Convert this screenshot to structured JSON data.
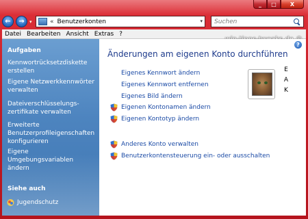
{
  "window": {
    "min_label": "_",
    "max_label": "□",
    "close_label": "X"
  },
  "nav": {
    "back_label": "←",
    "forward_label": "→",
    "dropdown_label": "▾",
    "address_separator": "«",
    "address_text": "Benutzerkonten",
    "address_dropdown_label": "▾",
    "refresh_label": "↻",
    "search_placeholder": "Suchen"
  },
  "menubar": {
    "items": [
      {
        "label": "Datei"
      },
      {
        "label": "Bearbeiten"
      },
      {
        "label": "Ansicht"
      },
      {
        "label": "Extras"
      },
      {
        "label": "?"
      }
    ]
  },
  "watermark": "win-tipps-tweaks.de ©",
  "sidebar": {
    "tasks_heading": "Aufgaben",
    "links": [
      {
        "label": "Kennwortrücksetzdiskette erstellen"
      },
      {
        "label": "Eigene Netzwerkkennwörter verwalten"
      },
      {
        "label": "Dateiverschlüsselungs-zertifikate verwalten"
      },
      {
        "label": "Erweiterte Benutzerprofileigenschaften konfigurieren"
      },
      {
        "label": "Eigene Umgebungsvariablen ändern"
      }
    ],
    "see_also_heading": "Siehe auch",
    "see_also_link": "Jugendschutz"
  },
  "main": {
    "help_label": "?",
    "title": "Änderungen am eigenen Konto durchführen",
    "plain_links": [
      {
        "label": "Eigenes Kennwort ändern"
      },
      {
        "label": "Eigenes Kennwort entfernen"
      },
      {
        "label": "Eigenes Bild ändern"
      }
    ],
    "shield_links": [
      {
        "label": "Eigenen Kontonamen ändern"
      },
      {
        "label": "Eigenen Kontotyp ändern"
      }
    ],
    "other_links": [
      {
        "label": "Anderes Konto verwalten"
      },
      {
        "label": "Benutzerkontensteuerung ein- oder ausschalten"
      }
    ],
    "user_letters": [
      "E",
      "A",
      "K"
    ]
  },
  "colors": {
    "frame": "#c51d26",
    "sidebar": "#4d84bf",
    "link": "#1a4aa5",
    "title": "#1e3b8c"
  }
}
